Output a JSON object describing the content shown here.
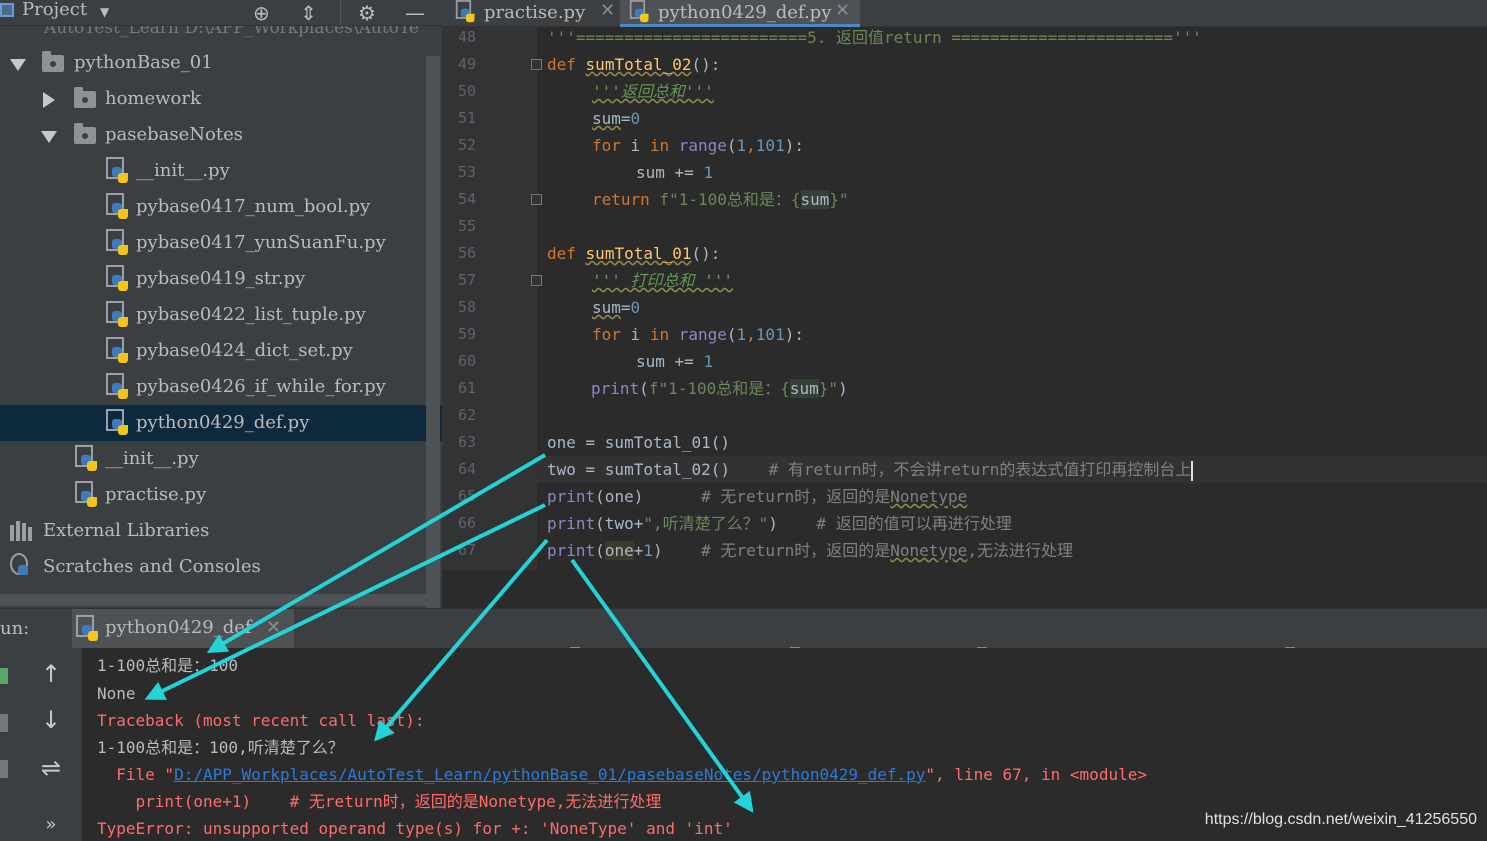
{
  "project_panel": {
    "title": "Project",
    "ghost_root": "AutoTest_Learn  D:\\APP_Workplaces\\AutoTe",
    "items": [
      {
        "label": "pythonBase_01",
        "type": "folder",
        "expanded": true
      },
      {
        "label": "homework",
        "type": "folder",
        "expanded": false
      },
      {
        "label": "pasebaseNotes",
        "type": "folder",
        "expanded": true
      },
      {
        "label": "__init__.py",
        "type": "py"
      },
      {
        "label": "pybase0417_num_bool.py",
        "type": "py"
      },
      {
        "label": "pybase0417_yunSuanFu.py",
        "type": "py"
      },
      {
        "label": "pybase0419_str.py",
        "type": "py"
      },
      {
        "label": "pybase0422_list_tuple.py",
        "type": "py"
      },
      {
        "label": "pybase0424_dict_set.py",
        "type": "py"
      },
      {
        "label": "pybase0426_if_while_for.py",
        "type": "py"
      },
      {
        "label": "python0429_def.py",
        "type": "py",
        "selected": true
      },
      {
        "label": "__init__.py",
        "type": "py"
      },
      {
        "label": "practise.py",
        "type": "py"
      },
      {
        "label": "External Libraries",
        "type": "libraries"
      },
      {
        "label": "Scratches and Consoles",
        "type": "scratches"
      }
    ]
  },
  "editor": {
    "tabs": [
      {
        "label": "practise.py",
        "close": "✕",
        "active": false
      },
      {
        "label": "python0429_def.py",
        "close": "✕",
        "active": true
      }
    ],
    "line_numbers": [
      "48",
      "49",
      "50",
      "51",
      "52",
      "53",
      "54",
      "55",
      "56",
      "57",
      "58",
      "59",
      "60",
      "61",
      "62",
      "63",
      "64",
      "65",
      "66",
      "67"
    ],
    "code": {
      "l48": {
        "a": "'''========================5. 返回值return ======================='''"
      },
      "l49": {
        "kw": "def",
        "fn": "sumTotal_02",
        "rest": "():"
      },
      "l50": {
        "doc": "'''返回总和'''"
      },
      "l51": {
        "a": "sum",
        "b": "=",
        "n": "0"
      },
      "l52": {
        "kw1": "for",
        "a": " i ",
        "kw2": "in",
        "bi": " range",
        "b": "(",
        "n1": "1",
        "c": ",",
        "n2": "101",
        "d": "):"
      },
      "l53": {
        "a": "sum += ",
        "n": "1"
      },
      "l54": {
        "kw": "return",
        "s1": " f\"1-100总和是：{",
        "v": "sum",
        "s2": "}\""
      },
      "l56": {
        "kw": "def",
        "fn": "sumTotal_01",
        "rest": "():"
      },
      "l57": {
        "doc": "''' 打印总和 '''"
      },
      "l58": {
        "a": "sum",
        "b": "=",
        "n": "0"
      },
      "l59": {
        "kw1": "for",
        "a": " i ",
        "kw2": "in",
        "bi": " range",
        "b": "(",
        "n1": "1",
        "c": ",",
        "n2": "101",
        "d": "):"
      },
      "l60": {
        "a": "sum += ",
        "n": "1"
      },
      "l61": {
        "bi": "print",
        "b": "(",
        "s1": "f\"1-100总和是：{",
        "v": "sum",
        "s2": "}\"",
        "c": ")"
      },
      "l63": {
        "a": "one = sumTotal_01()"
      },
      "l64": {
        "a": "two = sumTotal_02()    ",
        "cmt": "# 有return时，不会讲return的表达式值打印再控制台上"
      },
      "l65": {
        "bi": "print",
        "a": "(one)      ",
        "cmt1": "# 无return时，返回的是",
        "cmt2": "Nonetype"
      },
      "l66": {
        "bi": "print",
        "a": "(two+",
        "s": "\",听清楚了么？\"",
        "b": ")    ",
        "cmt": "# 返回的值可以再进行处理"
      },
      "l67": {
        "bi": "print",
        "a": "(",
        "v": "one",
        "b": "+",
        "n": "1",
        "c": ")    ",
        "cmt1": "# 无return时，返回的是",
        "cmt2": "Nonetype",
        "cmt3": ",无法进行处理"
      }
    }
  },
  "run_panel": {
    "label": "un:",
    "tab": {
      "label": "python0429_def",
      "close": "✕"
    },
    "toolbar": {
      "up": "↑",
      "down": "↓",
      "wrap": "⇌",
      "more": "»"
    },
    "console": {
      "l1": "1-100总和是：100",
      "l2": "None",
      "l3": "Traceback (most recent call last):",
      "l4": "1-100总和是：100,听清楚了么？",
      "l5_pre": "  File \"",
      "l5_link": "D:/APP_Workplaces/AutoTest_Learn/pythonBase_01/pasebaseNotes/python0429_def.py",
      "l5_post": "\", line 67, in <module>",
      "l6": "    print(one+1)    # 无return时，返回的是Nonetype,无法进行处理",
      "l7": "TypeError: unsupported operand type(s) for +: 'NoneType' and 'int'"
    }
  },
  "watermark": "https://blog.csdn.net/weixin_41256550",
  "colors": {
    "arrow": "#22d3d8",
    "keyword": "#cc7832",
    "function": "#ffc66d",
    "number": "#6897bb",
    "string": "#6a8759",
    "error": "#ff6b68",
    "link": "#287bde",
    "selection": "#0d293e"
  }
}
